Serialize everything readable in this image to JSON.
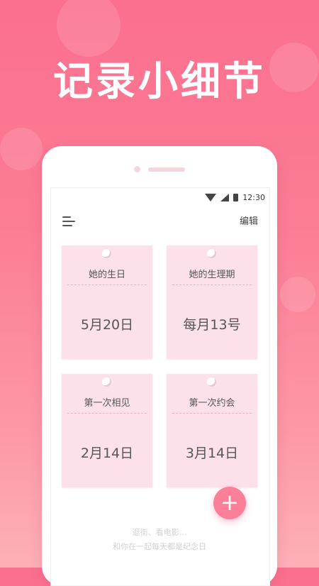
{
  "headline": "记录小细节",
  "status_bar": {
    "time": "12:30",
    "icons": [
      "wifi-icon",
      "signal-icon",
      "battery-icon"
    ]
  },
  "app_bar": {
    "menu_icon": "menu-icon",
    "edit_label": "编辑"
  },
  "cards": [
    {
      "title": "她的生日",
      "value": "5月20日"
    },
    {
      "title": "她的生理期",
      "value": "每月13号"
    },
    {
      "title": "第一次相见",
      "value": "2月14日"
    },
    {
      "title": "第一次约会",
      "value": "3月14日"
    }
  ],
  "fab_label": "+",
  "footer": {
    "line1": "逛街、看电影...",
    "line2": "和你在一起每天都是纪念日"
  },
  "colors": {
    "background_top": "#fb6f8f",
    "card": "#fde1ea",
    "fab": "#fb7f98"
  }
}
